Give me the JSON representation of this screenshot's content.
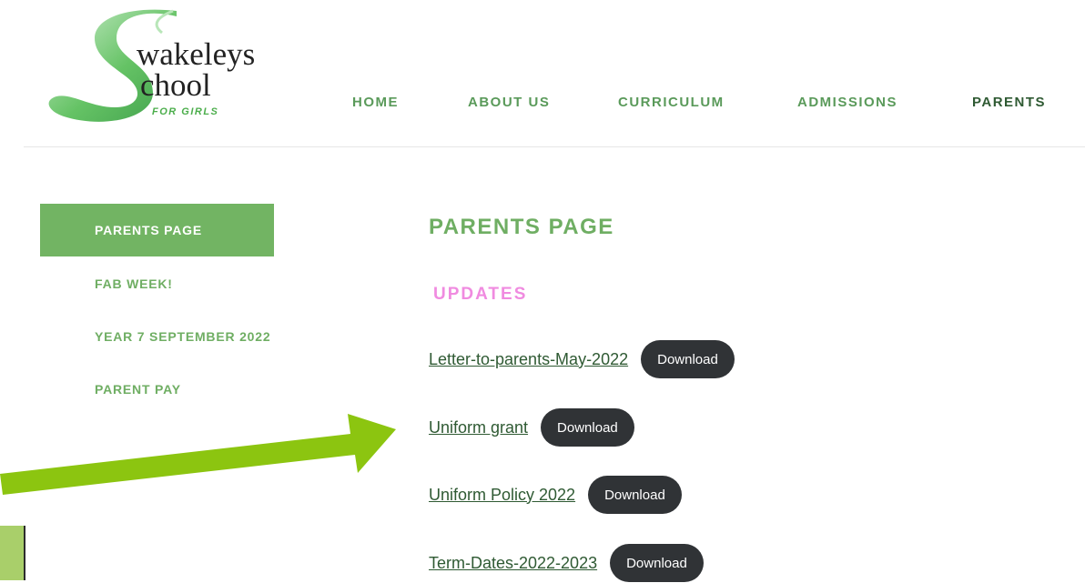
{
  "logo": {
    "line1": "wakeleys",
    "line2": "chool",
    "tagline": "FOR GIRLS"
  },
  "nav": [
    {
      "label": "HOME"
    },
    {
      "label": "ABOUT US"
    },
    {
      "label": "CURRICULUM"
    },
    {
      "label": "ADMISSIONS"
    },
    {
      "label": "PARENTS"
    }
  ],
  "sidebar": [
    {
      "label": "PARENTS PAGE"
    },
    {
      "label": "FAB WEEK!"
    },
    {
      "label": "YEAR 7 SEPTEMBER 2022"
    },
    {
      "label": "PARENT PAY"
    }
  ],
  "main": {
    "title": "PARENTS PAGE",
    "section": "UPDATES",
    "files": [
      {
        "name": "Letter-to-parents-May-2022",
        "button": "Download"
      },
      {
        "name": "Uniform grant",
        "button": "Download"
      },
      {
        "name": "Uniform Policy 2022",
        "button": "Download"
      },
      {
        "name": "Term-Dates-2022-2023",
        "button": "Download"
      }
    ]
  },
  "colors": {
    "brand_green": "#6fae63",
    "nav_green": "#5a9a5a",
    "active_dark_green": "#2f5a33",
    "updates_pink": "#f08be0",
    "button_dark": "#303336",
    "arrow_green": "#8cc510"
  }
}
